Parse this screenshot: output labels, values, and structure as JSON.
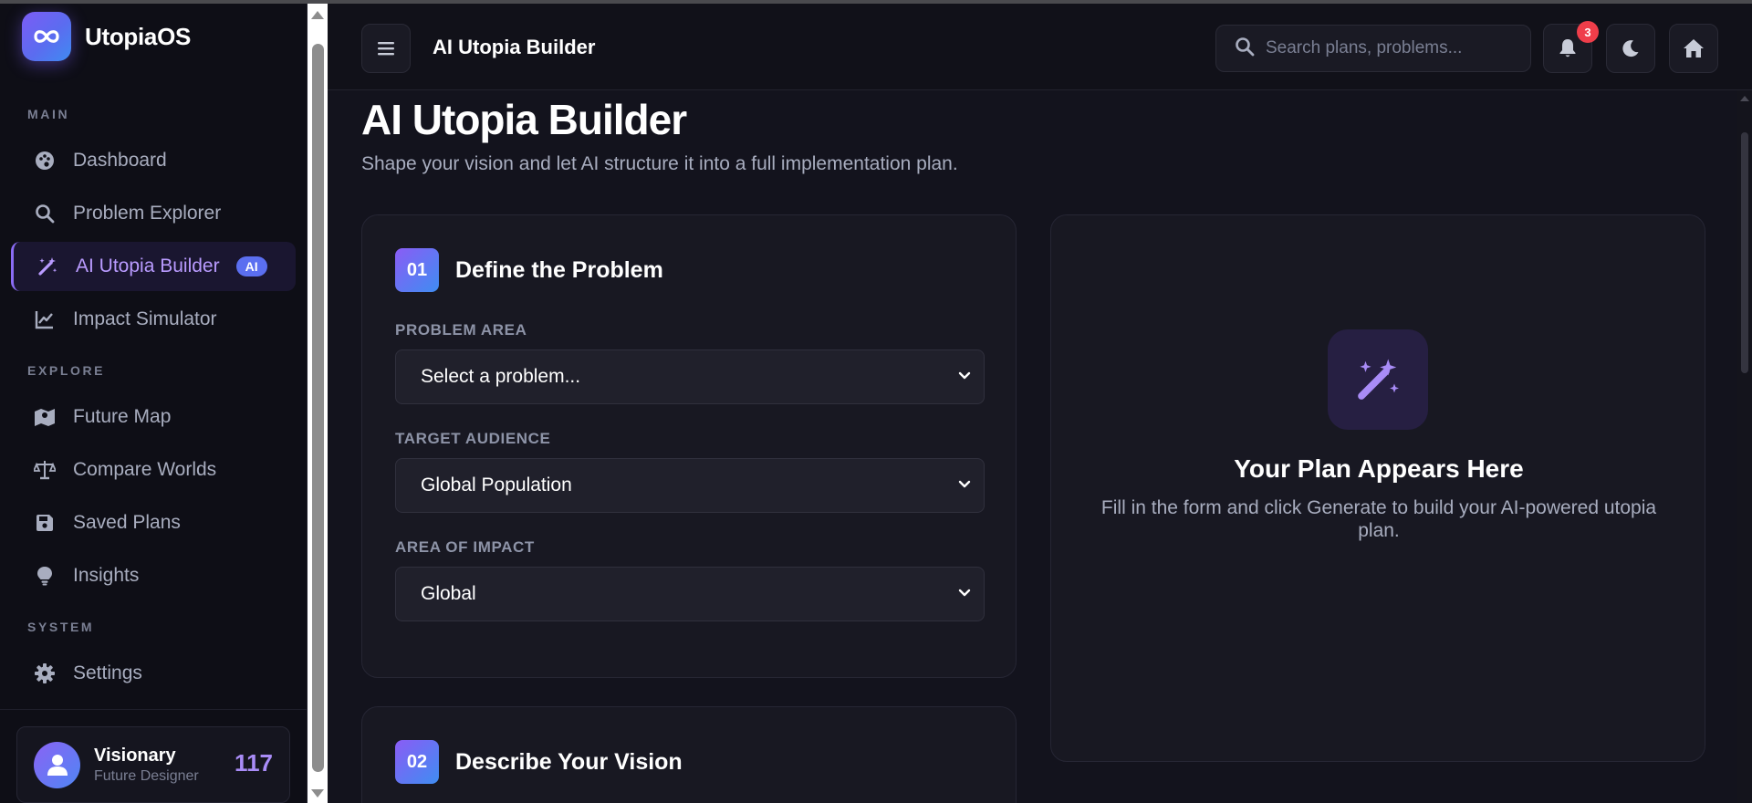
{
  "app": {
    "name": "UtopiaOS"
  },
  "sidebar": {
    "sections": [
      {
        "label": "MAIN"
      },
      {
        "label": "EXPLORE"
      },
      {
        "label": "SYSTEM"
      }
    ],
    "items": [
      {
        "label": "Dashboard",
        "icon": "palette-icon"
      },
      {
        "label": "Problem Explorer",
        "icon": "search-icon"
      },
      {
        "label": "AI Utopia Builder",
        "icon": "magic-wand-icon",
        "badge": "AI",
        "active": true
      },
      {
        "label": "Impact Simulator",
        "icon": "line-chart-icon"
      },
      {
        "label": "Future Map",
        "icon": "map-icon"
      },
      {
        "label": "Compare Worlds",
        "icon": "scale-icon"
      },
      {
        "label": "Saved Plans",
        "icon": "floppy-disk-icon"
      },
      {
        "label": "Insights",
        "icon": "lightbulb-icon"
      },
      {
        "label": "Settings",
        "icon": "gear-icon"
      }
    ],
    "profile": {
      "name": "Visionary",
      "role": "Future Designer",
      "score": "117"
    }
  },
  "header": {
    "title": "AI Utopia Builder",
    "search_placeholder": "Search plans, problems...",
    "notification_count": "3"
  },
  "main": {
    "title": "AI Utopia Builder",
    "subtitle": "Shape your vision and let AI structure it into a full implementation plan.",
    "steps": [
      {
        "number": "01",
        "title": "Define the Problem",
        "fields": [
          {
            "label": "PROBLEM AREA",
            "value": "Select a problem..."
          },
          {
            "label": "TARGET AUDIENCE",
            "value": "Global Population"
          },
          {
            "label": "AREA OF IMPACT",
            "value": "Global"
          }
        ]
      },
      {
        "number": "02",
        "title": "Describe Your Vision"
      }
    ],
    "placeholder": {
      "title": "Your Plan Appears Here",
      "description": "Fill in the form and click Generate to build your AI-powered utopia plan."
    }
  },
  "colors": {
    "accent": "#8b6cf6",
    "accent_blue": "#3f8df2",
    "badge_red": "#ef3e4a",
    "background": "#13131d",
    "sidebar": "#0e0e16",
    "card": "#181822"
  }
}
